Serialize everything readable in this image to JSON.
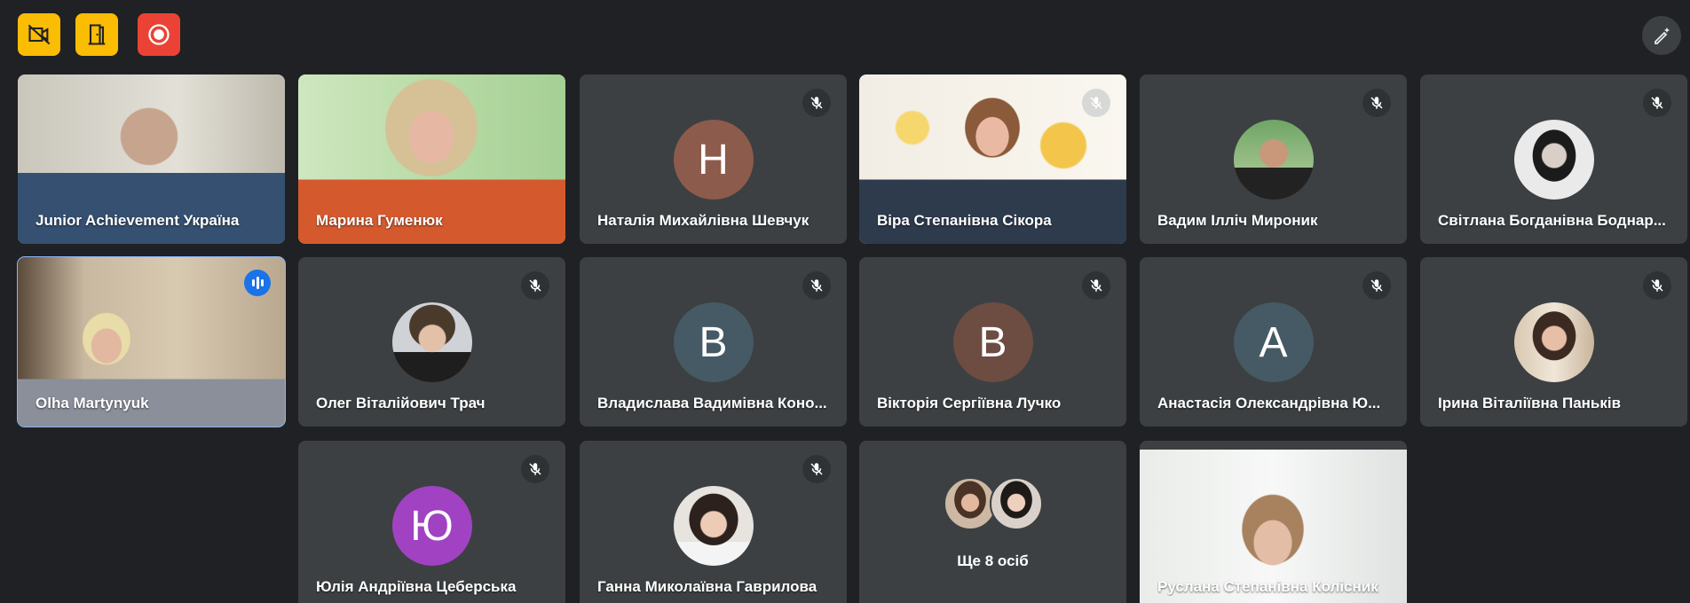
{
  "toolbar": {
    "buttons": [
      {
        "icon": "camera-off-icon",
        "color": "#fbbc04"
      },
      {
        "icon": "door-icon",
        "color": "#fbbc04"
      },
      {
        "icon": "record-icon",
        "color": "#ea4335"
      }
    ],
    "right_icon": "pen-sparkle-icon"
  },
  "participants": [
    {
      "name": "Junior Achievement Україна",
      "type": "video",
      "muted": false
    },
    {
      "name": "Марина Гуменюк",
      "type": "video",
      "muted": false
    },
    {
      "name": "Наталія Михайлівна Шевчук",
      "type": "letter",
      "letter": "Н",
      "avatar_color": "#8d5b4c",
      "muted": true
    },
    {
      "name": "Віра Степанівна Сікора",
      "type": "video",
      "muted": true
    },
    {
      "name": "Вадим Ілліч Мироник",
      "type": "photo",
      "muted": true
    },
    {
      "name": "Світлана Богданівна Боднар...",
      "type": "photo",
      "muted": true
    },
    {
      "name": "Olha Martynyuk",
      "type": "video",
      "muted": false,
      "speaking": true
    },
    {
      "name": "Олег Віталійович Трач",
      "type": "photo",
      "muted": true
    },
    {
      "name": "Владислава Вадимівна Коно...",
      "type": "letter",
      "letter": "В",
      "avatar_color": "#465a65",
      "muted": true
    },
    {
      "name": "Вікторія Сергіївна Лучко",
      "type": "letter",
      "letter": "В",
      "avatar_color": "#6d4c41",
      "muted": true
    },
    {
      "name": "Анастасія Олександрівна Ю...",
      "type": "letter",
      "letter": "А",
      "avatar_color": "#455a64",
      "muted": true
    },
    {
      "name": "Ірина Віталіївна Паньків",
      "type": "photo",
      "muted": true
    },
    {
      "name": "Юлія Андріївна Цеберська",
      "type": "letter",
      "letter": "Ю",
      "avatar_color": "#a142c2",
      "muted": true
    },
    {
      "name": "Ганна Миколаївна Гаврилова",
      "type": "photo",
      "muted": true
    },
    {
      "name": "Руслана Степанівна Колісник",
      "type": "video",
      "muted": false
    }
  ],
  "overflow": {
    "label": "Ще 8 осіб"
  }
}
